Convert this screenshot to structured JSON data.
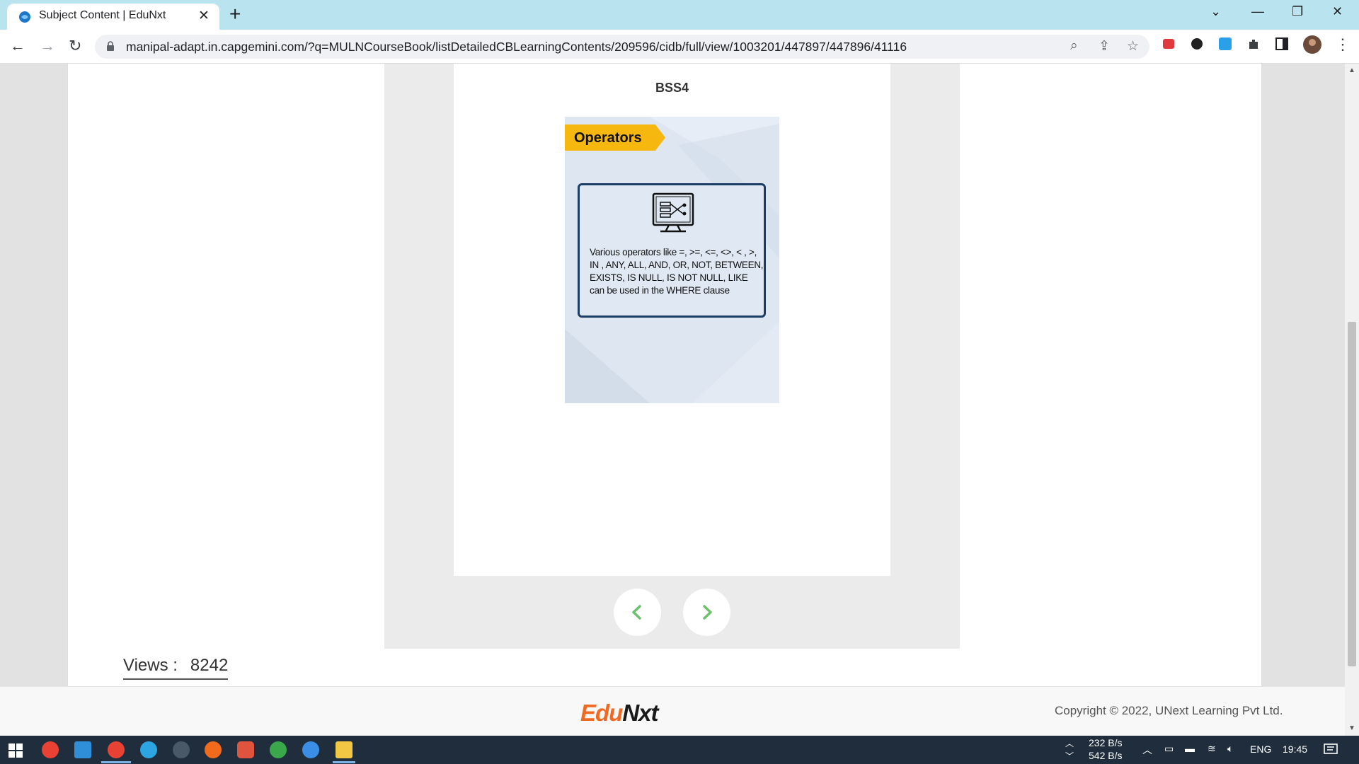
{
  "browser": {
    "tab_title": "Subject Content | EduNxt",
    "url": "manipal-adapt.in.capgemini.com/?q=MULNCourseBook/listDetailedCBLearningContents/209596/cidb/full/view/1003201/447897/447896/41116"
  },
  "slide": {
    "title": "BSS4",
    "tag": "Operators",
    "body": "Various operators like =, >=, <=, <>, < , >, IN , ANY, ALL, AND, OR, NOT, BETWEEN, EXISTS, IS NULL, IS NOT NULL, LIKE can be used in the WHERE clause"
  },
  "stats": {
    "views_label": "Views :",
    "views_count": "8242"
  },
  "footer": {
    "logo_edu": "Edu",
    "logo_nxt": "Nxt",
    "copyright": "Copyright © 2022, UNext Learning Pvt Ltd."
  },
  "taskbar": {
    "net_up": "232 B/s",
    "net_down": "542 B/s",
    "language": "ENG",
    "time": "19:45"
  },
  "colors": {
    "accent_tab_bar": "#b9e3ee",
    "slide_tag": "#f6b70e",
    "nav_arrow": "#6cc16c",
    "logo_orange": "#f06a23"
  }
}
